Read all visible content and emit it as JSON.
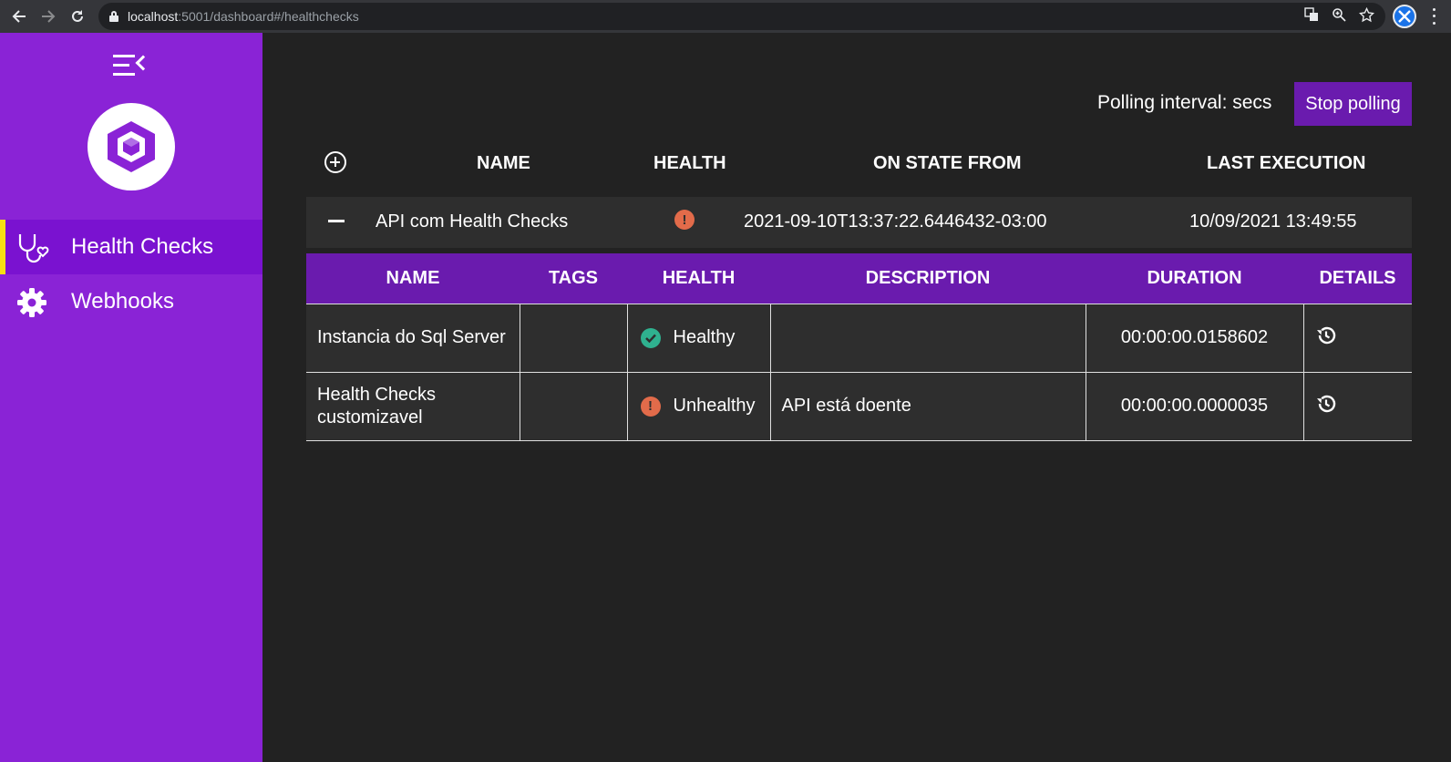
{
  "browser": {
    "url_host": "localhost",
    "url_rest": ":5001/dashboard#/healthchecks",
    "icons": [
      "back-icon",
      "forward-icon",
      "reload-icon",
      "lock-icon",
      "translate-icon",
      "zoom-icon",
      "star-icon",
      "profile-icon",
      "menu-icon"
    ]
  },
  "sidebar": {
    "items": [
      {
        "label": "Health Checks",
        "icon": "stethoscope-icon",
        "active": true
      },
      {
        "label": "Webhooks",
        "icon": "gear-icon",
        "active": false
      }
    ],
    "accent": "#f6e012",
    "background": "#8a23d6"
  },
  "toolbar": {
    "polling_text": "Polling interval: secs",
    "stop_label": "Stop polling"
  },
  "outer_table": {
    "headers": {
      "name": "NAME",
      "health": "HEALTH",
      "on_state_from": "ON STATE FROM",
      "last_execution": "LAST EXECUTION"
    },
    "row": {
      "name": "API com Health Checks",
      "health": "unhealthy",
      "on_state_from": "2021-09-10T13:37:22.6446432-03:00",
      "last_execution": "10/09/2021 13:49:55"
    }
  },
  "inner_table": {
    "headers": [
      "NAME",
      "TAGS",
      "HEALTH",
      "DESCRIPTION",
      "DURATION",
      "DETAILS"
    ],
    "rows": [
      {
        "name": "Instancia do Sql Server",
        "tags": "",
        "health": "Healthy",
        "description": "",
        "duration": "00:00:00.0158602"
      },
      {
        "name": "Health Checks customizavel",
        "tags": "",
        "health": "Unhealthy",
        "description": "API está doente",
        "duration": "00:00:00.0000035"
      }
    ]
  },
  "colors": {
    "healthy": "#2fb18f",
    "unhealthy": "#e26b4a",
    "header_bg": "#6a1bae"
  }
}
